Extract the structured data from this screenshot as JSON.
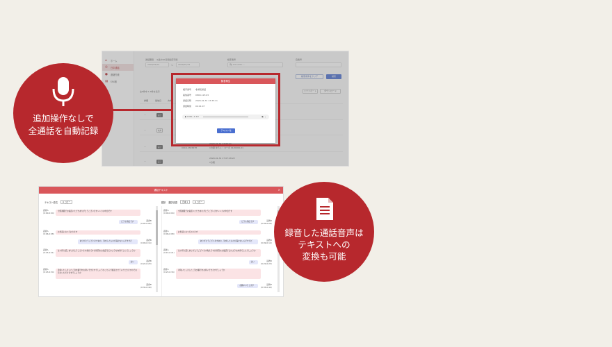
{
  "colors": {
    "accent": "#b7282d",
    "header": "#d9565a",
    "background": "#f2efe8",
    "primary_button": "#4a6fd0"
  },
  "callouts": {
    "record": {
      "icon": "microphone-icon",
      "line1": "追加操作なしで",
      "line2": "全通話を自動記録"
    },
    "transcript": {
      "icon": "document-icon",
      "line1": "録音した通話音声は",
      "line2": "テキストへの",
      "line3": "変換も可能"
    }
  },
  "app": {
    "sidebar": [
      {
        "icon": "home-icon",
        "label": "ホーム"
      },
      {
        "icon": "phone-icon",
        "label": "日中通話"
      },
      {
        "icon": "user-icon",
        "label": "連絡先帳"
      },
      {
        "icon": "print-icon",
        "label": "FAX帳"
      }
    ],
    "filters": {
      "period_label": "通話期間",
      "period_note": "※最大90日間指定可能",
      "start": "2020/01/01",
      "tilde": "～",
      "end": "2020/01/31",
      "partner_label": "相手番号",
      "partner_placeholder": "例) 03-1234-...",
      "self_label": "自番号"
    },
    "buttons": {
      "clear": "検索条件をクリア",
      "search": "検索",
      "download": "ダウンロード",
      "export": "エクスポート"
    },
    "count_text": "全8件中 1-8件を表示",
    "table_header": [
      "詳細",
      "着信日",
      "方向"
    ],
    "rows": [
      {
        "tag": "完了",
        "date": "",
        "number": "",
        "detail": ""
      },
      {
        "tag": "未対",
        "date": "",
        "number": "",
        "detail": ""
      },
      {
        "tag": "完了",
        "date": "2020-01-31 13:05:21",
        "number": "000-12345678",
        "detail": "1分間 ゆうこ・コーポ 0120000-01"
      },
      {
        "tag": "完了",
        "date": "2020-01-31 17:07:28.22",
        "number": "",
        "detail": "1分間"
      }
    ]
  },
  "modal": {
    "title": "録音再生",
    "fields": [
      {
        "label": "相手番号",
        "value": "非通知通話"
      },
      {
        "label": "着信番号",
        "value": "0800-1234-5"
      },
      {
        "label": "通話日時",
        "value": "2020-01-31 13:35:11"
      },
      {
        "label": "通話時間",
        "value": "00:01:07"
      }
    ],
    "player_time": "0:00 / 1:10",
    "button": "テキスト化"
  },
  "transcript_window": {
    "title": "通話テキスト",
    "left_header": "テキスト原文",
    "right_header": "翻訳",
    "lang_label": "翻訳言語",
    "lang": "日本",
    "copy": "コピー",
    "left": [
      {
        "speaker": "話者A",
        "time": "(0:00-0:04)",
        "side": "left",
        "text": "全国通販でお電話いただきありがとうございますシンカの中田です",
        "color": "p"
      },
      {
        "speaker": "話者B",
        "time": "(0:05-0:06)",
        "side": "right",
        "text": "どうも池田です",
        "color": "b"
      },
      {
        "speaker": "話者A",
        "time": "(0:06-0:08)",
        "side": "left",
        "text": "お世話になっております",
        "color": "p"
      },
      {
        "speaker": "話者B",
        "time": "(0:09-0:14)",
        "side": "right",
        "text": "ありがとうございますあの、注文したものが届かないんですけど",
        "color": "b"
      },
      {
        "speaker": "話者A",
        "time": "(0:15-0:21)",
        "side": "left",
        "text": "はい折り返しありがとうございます失礼ですが前回のお電話でどのような内容でしたでしょうか",
        "color": "p"
      },
      {
        "speaker": "話者B",
        "time": "(0:22-0:23)",
        "side": "right",
        "text": "はい",
        "color": "b"
      },
      {
        "speaker": "話者A",
        "time": "(0:23-0:34)",
        "side": "left",
        "text": "承知いたしましたご注文番号をお伺いできますでしょうかこちらで確認させていただきますのでお待ちいただけますでしょうか",
        "color": "p"
      },
      {
        "speaker": "話者B",
        "time": "(0:34-0:40)",
        "side": "right",
        "text": "",
        "color": "b"
      }
    ],
    "right": [
      {
        "speaker": "話者A",
        "time": "(0:00-0:04)",
        "side": "left",
        "text": "全国通販でお電話いただきありがとうございますシンカの中田です",
        "color": "p"
      },
      {
        "speaker": "話者B",
        "time": "(0:05-0:06)",
        "side": "right",
        "text": "どうも池田です",
        "color": "b"
      },
      {
        "speaker": "話者A",
        "time": "(0:06-0:08)",
        "side": "left",
        "text": "お世話になっております",
        "color": "p"
      },
      {
        "speaker": "話者B",
        "time": "(0:09-0:14)",
        "side": "right",
        "text": "ありがとうございますあの、注文したものが届かないんですけど",
        "color": "b"
      },
      {
        "speaker": "話者A",
        "time": "(0:15-0:21)",
        "side": "left",
        "text": "はい折り返しありがとうございます失礼ですが前回のお電話でどのような内容でしたでしょうか",
        "color": "p"
      },
      {
        "speaker": "話者B",
        "time": "(0:22-0:23)",
        "side": "right",
        "text": "はい",
        "color": "b"
      },
      {
        "speaker": "話者A",
        "time": "(0:23-0:34)",
        "side": "left",
        "text": "承知いたしましたご注文番号をお伺いできますでしょうか",
        "color": "p"
      },
      {
        "speaker": "話者B",
        "time": "(0:35-0:40)",
        "side": "right",
        "text": "お願いいたします",
        "color": "b"
      }
    ]
  }
}
